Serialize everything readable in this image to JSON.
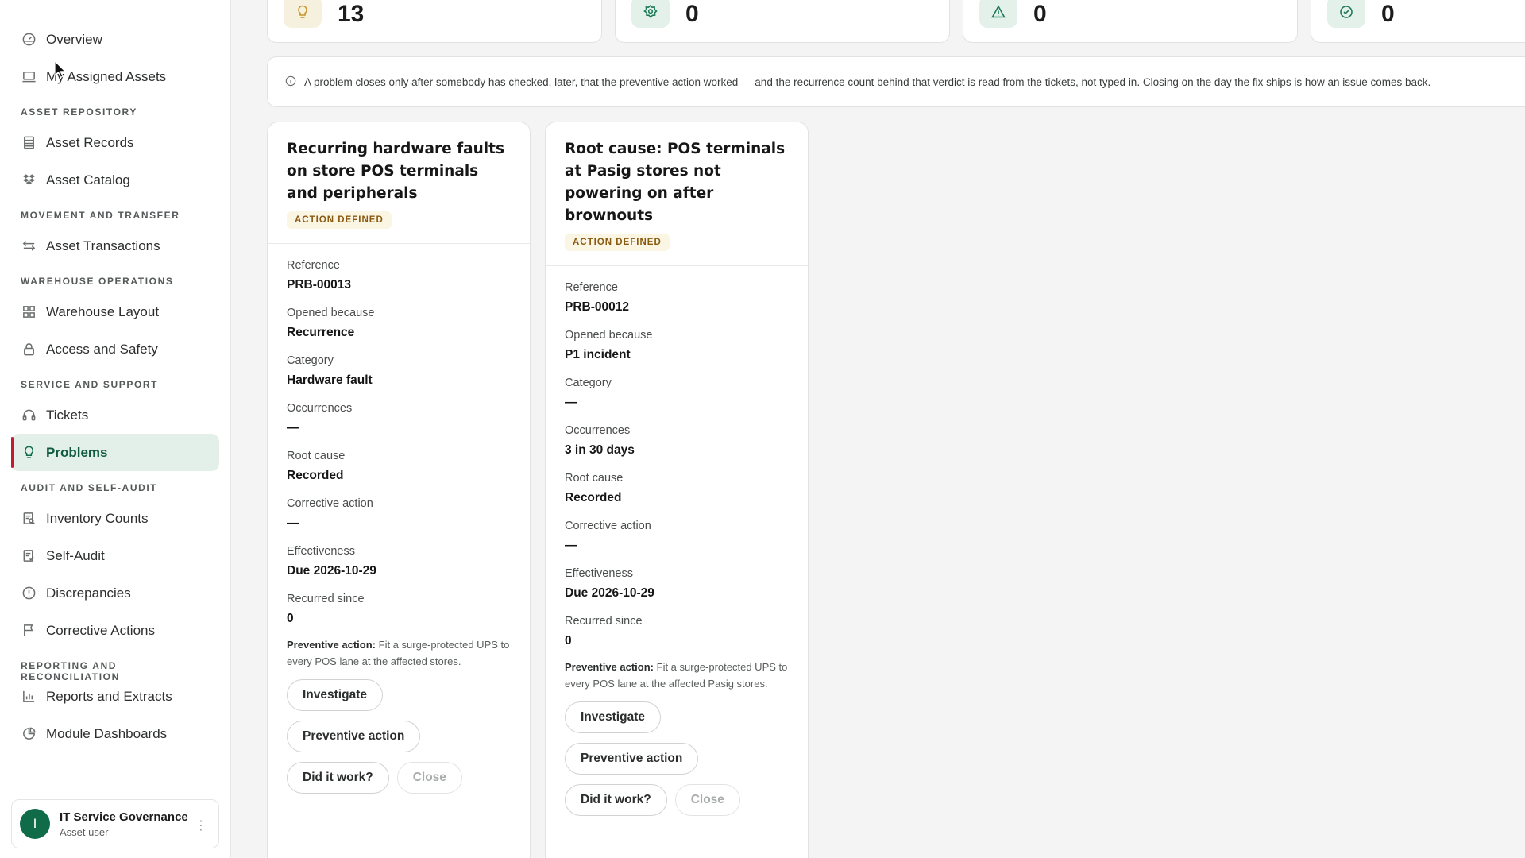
{
  "sidebar": {
    "top_items": [
      {
        "label": "Overview",
        "icon": "gauge-icon"
      },
      {
        "label": "My Assigned Assets",
        "icon": "laptop-icon"
      }
    ],
    "sections": [
      {
        "label": "ASSET REPOSITORY",
        "items": [
          {
            "label": "Asset Records",
            "icon": "records-icon"
          },
          {
            "label": "Asset Catalog",
            "icon": "dropbox-icon"
          }
        ]
      },
      {
        "label": "MOVEMENT AND TRANSFER",
        "items": [
          {
            "label": "Asset Transactions",
            "icon": "arrows-icon"
          }
        ]
      },
      {
        "label": "WAREHOUSE OPERATIONS",
        "items": [
          {
            "label": "Warehouse Layout",
            "icon": "grid-icon"
          },
          {
            "label": "Access and Safety",
            "icon": "lock-icon"
          }
        ]
      },
      {
        "label": "SERVICE AND SUPPORT",
        "items": [
          {
            "label": "Tickets",
            "icon": "headset-icon"
          },
          {
            "label": "Problems",
            "icon": "lightbulb-icon",
            "active": true
          }
        ]
      },
      {
        "label": "AUDIT AND SELF-AUDIT",
        "items": [
          {
            "label": "Inventory Counts",
            "icon": "clipboard-search-icon"
          },
          {
            "label": "Self-Audit",
            "icon": "clipboard-check-icon"
          },
          {
            "label": "Discrepancies",
            "icon": "alert-circle-icon"
          },
          {
            "label": "Corrective Actions",
            "icon": "flag-icon"
          }
        ]
      },
      {
        "label": "REPORTING AND RECONCILIATION",
        "items": [
          {
            "label": "Reports and Extracts",
            "icon": "bar-chart-icon"
          },
          {
            "label": "Module Dashboards",
            "icon": "pie-chart-icon"
          }
        ]
      }
    ],
    "user": {
      "initial": "I",
      "name": "IT Service Governance",
      "role": "Asset user"
    }
  },
  "kpis": [
    {
      "value": "13",
      "icon": "lightbulb-icon",
      "color": "#c9962a"
    },
    {
      "value": "0",
      "icon": "badge-icon",
      "color": "#1f7a58"
    },
    {
      "value": "0",
      "icon": "warning-icon",
      "color": "#1f7a58"
    },
    {
      "value": "0",
      "icon": "check-circle-icon",
      "color": "#1f7a58"
    }
  ],
  "notice": {
    "text": "A problem closes only after somebody has checked, later, that the preventive action worked — and the recurrence count behind that verdict is read from the tickets, not typed in. Closing on the day the fix ships is how an issue comes back."
  },
  "labels": {
    "reference": "Reference",
    "opened_because": "Opened because",
    "category": "Category",
    "occurrences": "Occurrences",
    "root_cause": "Root cause",
    "corrective_action": "Corrective action",
    "effectiveness": "Effectiveness",
    "recurred_since": "Recurred since",
    "preventive_prefix": "Preventive action:",
    "investigate": "Investigate",
    "preventive_button": "Preventive action",
    "did_it_work": "Did it work?",
    "close": "Close"
  },
  "problems": [
    {
      "title": "Recurring hardware faults on store POS terminals and peripherals",
      "status": "ACTION DEFINED",
      "reference": "PRB-00013",
      "opened_because": "Recurrence",
      "category": "Hardware fault",
      "occurrences": "—",
      "root_cause": "Recorded",
      "corrective_action": "—",
      "effectiveness": "Due 2026-10-29",
      "recurred_since": "0",
      "preventive_text": "Fit a surge-protected UPS to every POS lane at the affected stores."
    },
    {
      "title": "Root cause: POS terminals at Pasig stores not powering on after brownouts",
      "status": "ACTION DEFINED",
      "reference": "PRB-00012",
      "opened_because": "P1 incident",
      "category": "—",
      "occurrences": "3 in 30 days",
      "root_cause": "Recorded",
      "corrective_action": "—",
      "effectiveness": "Due 2026-10-29",
      "recurred_since": "0",
      "preventive_text": "Fit a surge-protected UPS to every POS lane at the affected Pasig stores."
    }
  ]
}
